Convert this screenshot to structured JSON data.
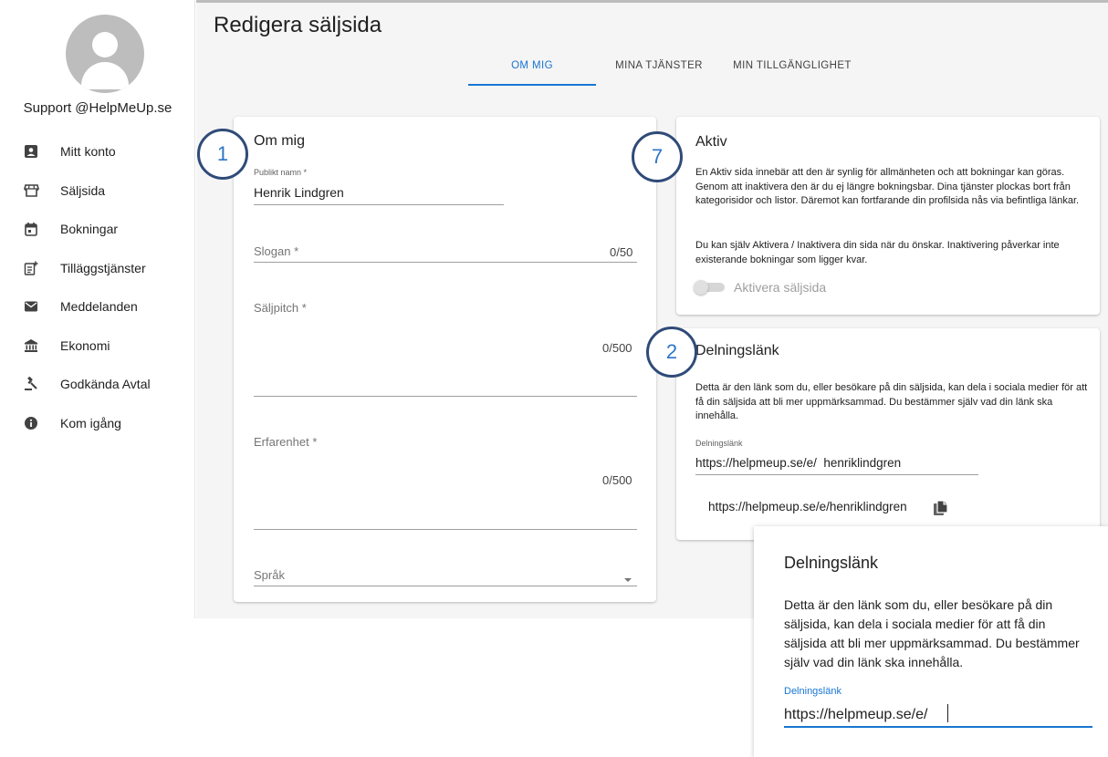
{
  "user": {
    "name": "Support @HelpMeUp.se"
  },
  "sidebar": {
    "items": [
      {
        "label": "Mitt konto",
        "icon": "account-box-icon"
      },
      {
        "label": "Säljsida",
        "icon": "storefront-icon"
      },
      {
        "label": "Bokningar",
        "icon": "calendar-icon"
      },
      {
        "label": "Tilläggstjänster",
        "icon": "add-list-icon"
      },
      {
        "label": "Meddelanden",
        "icon": "mail-icon"
      },
      {
        "label": "Ekonomi",
        "icon": "bank-icon"
      },
      {
        "label": "Godkända Avtal",
        "icon": "gavel-icon"
      },
      {
        "label": "Kom igång",
        "icon": "info-icon"
      }
    ]
  },
  "page": {
    "title": "Redigera säljsida"
  },
  "tabs": [
    {
      "label": "OM MIG",
      "active": true
    },
    {
      "label": "MINA TJÄNSTER",
      "active": false
    },
    {
      "label": "MIN TILLGÄNGLIGHET",
      "active": false
    }
  ],
  "about": {
    "title": "Om mig",
    "public_name_label": "Publikt namn *",
    "public_name_value": "Henrik Lindgren",
    "slogan_label": "Slogan *",
    "slogan_counter": "0/50",
    "pitch_label": "Säljpitch *",
    "pitch_counter": "0/500",
    "experience_label": "Erfarenhet *",
    "experience_counter": "0/500",
    "language_label": "Språk"
  },
  "active": {
    "title": "Aktiv",
    "text1": "En Aktiv sida innebär att den är synlig för allmänheten och att bokningar kan göras. Genom att inaktivera den är du ej längre bokningsbar. Dina tjänster plockas bort från kategorisidor och listor. Däremot kan fortfarande din profilsida nås via befintliga länkar.",
    "text2": "Du kan själv Aktivera / Inaktivera din sida när du önskar. Inaktivering påverkar inte existerande bokningar som ligger kvar.",
    "toggle_label": "Aktivera säljsida",
    "toggle_on": false
  },
  "share": {
    "title": "Delningslänk",
    "text": "Detta är den länk som du, eller besökare på din säljsida, kan dela i sociala medier för att få din säljsida att bli mer uppmärksammad. Du bestämmer själv vad din länk ska innehålla.",
    "field_label": "Delningslänk",
    "field_value": "https://helpmeup.se/e/  henriklindgren",
    "full_link": "https://helpmeup.se/e/henriklindgren"
  },
  "zoom": {
    "title": "Delningslänk",
    "text": "Detta är den länk som du, eller besökare på din säljsida, kan dela i sociala medier för att få din säljsida att bli mer uppmärksammad. Du bestämmer själv vad din länk ska innehålla.",
    "field_label": "Delningslänk",
    "field_value": "https://helpmeup.se/e/"
  },
  "badges": [
    "1",
    "7",
    "2"
  ],
  "colors": {
    "accent": "#1976d2",
    "badge_border": "#2f4b78",
    "badge_text": "#2e75c7"
  }
}
